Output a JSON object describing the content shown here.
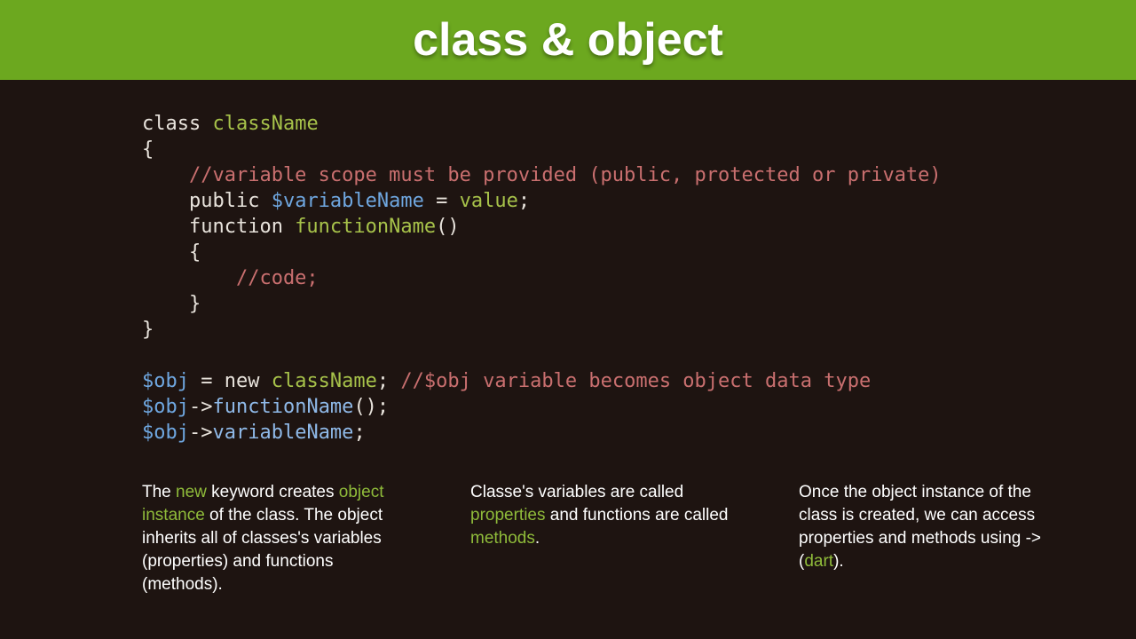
{
  "header": {
    "title": "class & object"
  },
  "code": {
    "l1a": "class ",
    "l1b": "className",
    "l2": "{",
    "l3": "    //variable scope must be provided (public, protected or private)",
    "l4a": "    public ",
    "l4b": "$variableName",
    "l4c": " = ",
    "l4d": "value",
    "l4e": ";",
    "l5a": "    function ",
    "l5b": "functionName",
    "l5c": "()",
    "l6": "    {",
    "l7": "        //code;",
    "l8": "    }",
    "l9": "}",
    "l11a": "$obj",
    "l11b": " = new ",
    "l11c": "className",
    "l11d": "; ",
    "l11e": "//$obj variable becomes object data type",
    "l12a": "$obj",
    "l12b": "->",
    "l12c": "functionName",
    "l12d": "();",
    "l13a": "$obj",
    "l13b": "->",
    "l13c": "variableName",
    "l13d": ";"
  },
  "cols": {
    "a1": "The ",
    "a2": "new",
    "a3": " keyword creates ",
    "a4": "object instance",
    "a5": " of the class. The object inherits all of classes's variables (properties) and functions (methods).",
    "b1": "Classe's variables are called ",
    "b2": "properties",
    "b3": " and functions are called ",
    "b4": "methods",
    "b5": ".",
    "c1": "Once the object instance of the class is created, we can access properties and methods using -> (",
    "c2": "dart",
    "c3": ")."
  }
}
